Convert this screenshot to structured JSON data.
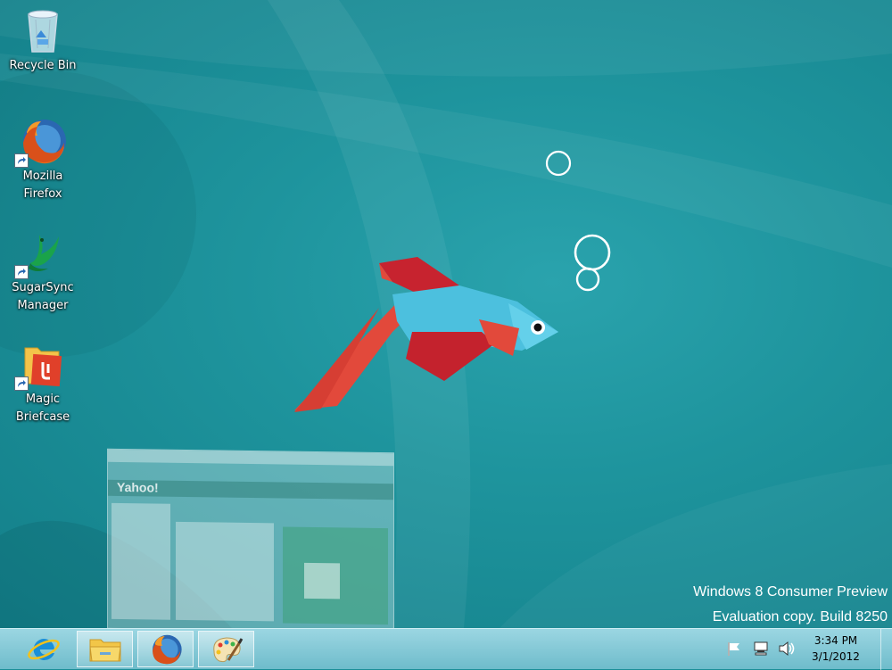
{
  "desktop_icons": [
    {
      "label": "Recycle Bin",
      "icon": "recycle-bin-icon"
    },
    {
      "label": "Mozilla\nFirefox",
      "icon": "firefox-icon"
    },
    {
      "label": "SugarSync\nManager",
      "icon": "sugarsync-icon"
    },
    {
      "label": "Magic\nBriefcase",
      "icon": "magic-briefcase-icon"
    }
  ],
  "labels": {
    "recycle_bin": "Recycle Bin",
    "firefox_1": "Mozilla",
    "firefox_2": "Firefox",
    "sugarsync_1": "SugarSync",
    "sugarsync_2": "Manager",
    "briefcase_1": "Magic",
    "briefcase_2": "Briefcase"
  },
  "watermark": {
    "line1": "Windows 8 Consumer Preview",
    "line2": "Evaluation copy. Build 8250"
  },
  "ghost_window": {
    "logo": "Yahoo!"
  },
  "taskbar": {
    "pinned": [
      {
        "name": "internet-explorer",
        "icon": "ie-icon",
        "running": false
      },
      {
        "name": "file-explorer",
        "icon": "folder-icon",
        "running": true
      },
      {
        "name": "firefox",
        "icon": "firefox-icon",
        "running": true
      },
      {
        "name": "paint",
        "icon": "paint-icon",
        "running": true
      }
    ],
    "tray": [
      "action-center-flag-icon",
      "network-icon",
      "volume-icon"
    ],
    "clock": {
      "time": "3:34 PM",
      "date": "3/1/2012"
    }
  },
  "colors": {
    "wallpaper": "#1b8e97",
    "fish_body": "#4fc3e0",
    "fish_red": "#c8242f",
    "fish_orange": "#e0483a"
  }
}
